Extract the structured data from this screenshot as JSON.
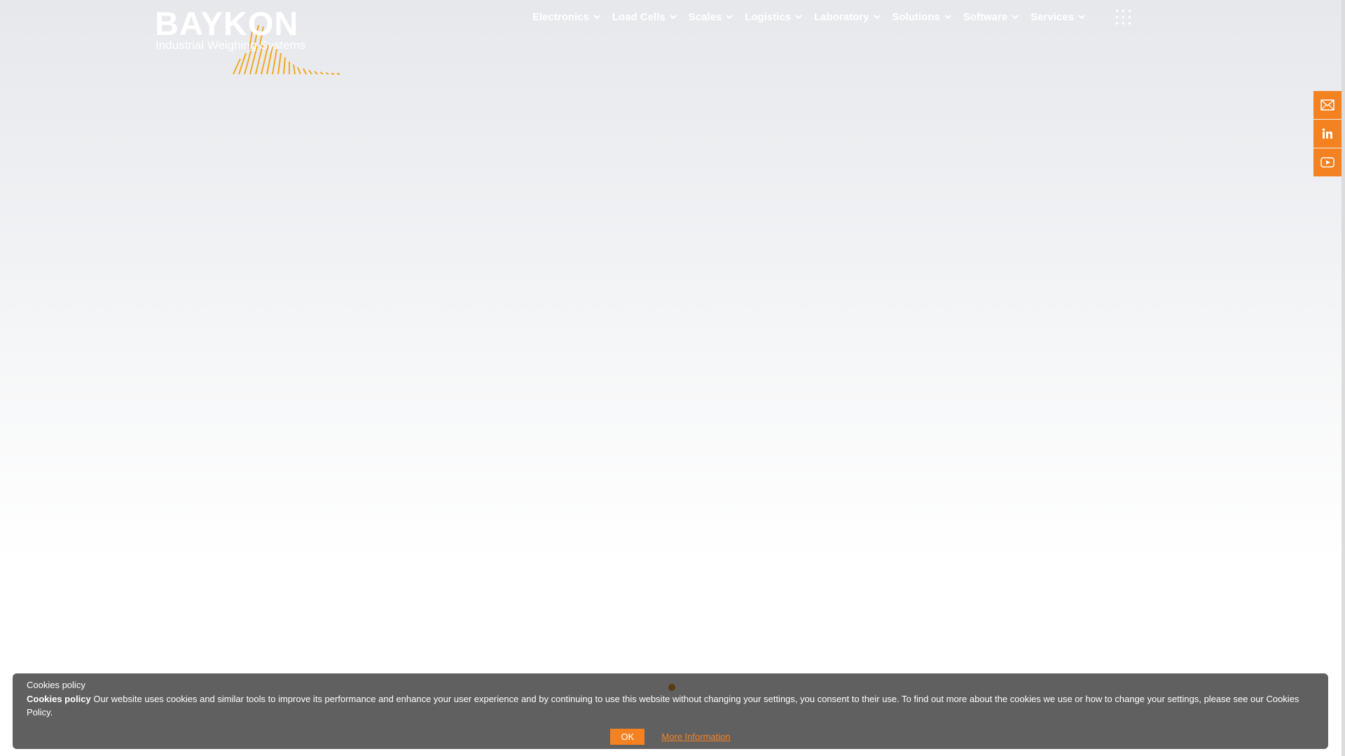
{
  "logo": {
    "title": "BAYKON",
    "subtitle": "Industrial Weighing Systems"
  },
  "nav": {
    "items": [
      {
        "label": "Electronics"
      },
      {
        "label": "Load Cells"
      },
      {
        "label": "Scales"
      },
      {
        "label": "Logistics"
      },
      {
        "label": "Laboratory"
      },
      {
        "label": "Solutions"
      },
      {
        "label": "Software"
      },
      {
        "label": "Services"
      }
    ],
    "menu_icon": "grid-menu-icon"
  },
  "social": {
    "items": [
      {
        "icon": "mail-icon"
      },
      {
        "icon": "linkedin-icon"
      },
      {
        "icon": "youtube-icon"
      }
    ]
  },
  "cookie": {
    "heading": "Cookies policy",
    "bold_label": "Cookies policy",
    "text": " Our website uses cookies and similar tools to improve its performance and enhance your user experience and by continuing to use this website without changing your settings, you consent to their use. To find out more about the cookies we use or how to change your settings, please see our Cookies Policy.",
    "ok_label": "OK",
    "more_label": "More Information"
  },
  "colors": {
    "accent": "#f58220",
    "banner_bg": "#5a5a5a",
    "nav_text": "#ffffff"
  }
}
